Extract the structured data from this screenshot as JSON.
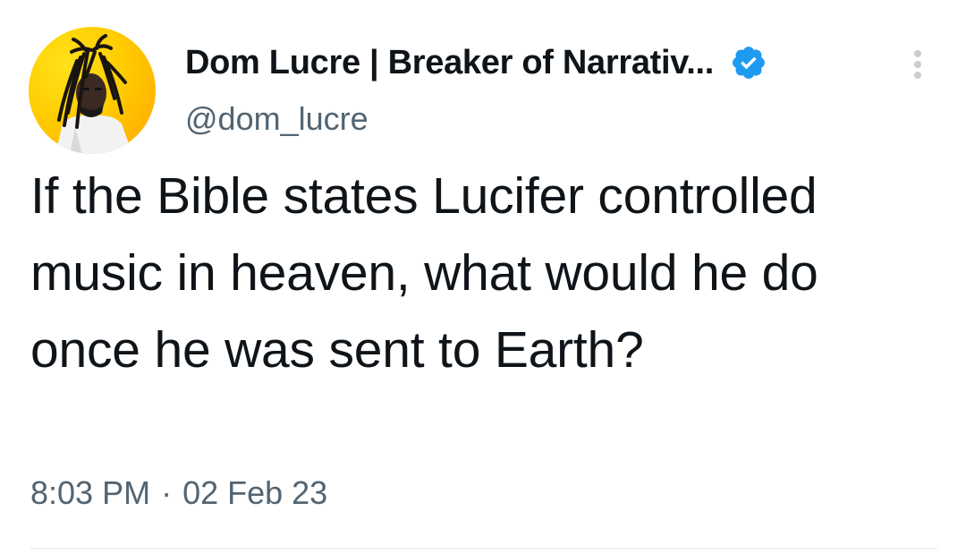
{
  "tweet": {
    "author": {
      "display_name": "Dom Lucre | Breaker of Narrativ...",
      "handle": "@dom_lucre",
      "verified": true,
      "avatar_icon": "profile-photo",
      "avatar_bg_color": "#ffcc00"
    },
    "text": "If the Bible states Lucifer controlled music in heaven, what would he do once he was sent to Earth?",
    "time": "8:03 PM",
    "separator": "·",
    "date": "02 Feb 23",
    "more_icon": "more-vertical-icon",
    "verified_icon": "verified-badge-icon"
  },
  "colors": {
    "text_primary": "#0f1419",
    "text_secondary": "#536471",
    "verified_blue": "#1d9bf0",
    "divider": "#eff3f4"
  }
}
